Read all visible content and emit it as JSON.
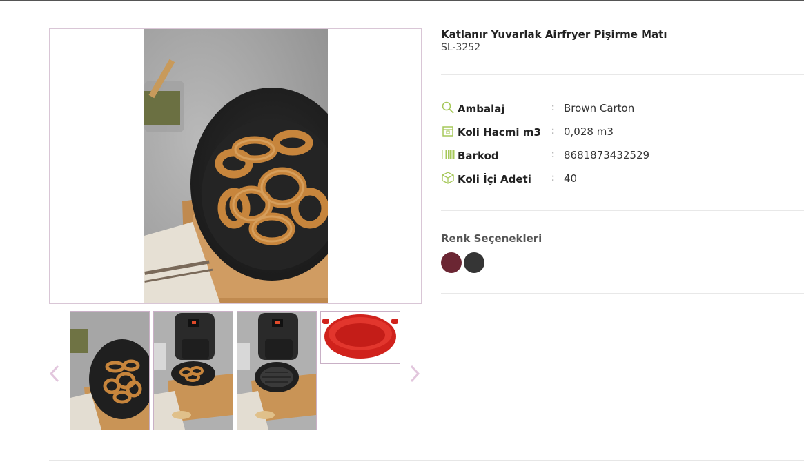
{
  "product": {
    "title": "Katlanır Yuvarlak Airfryer Pişirme Matı",
    "code": "SL-3252"
  },
  "specs": [
    {
      "icon": "magnifier-icon",
      "label": "Ambalaj",
      "value": "Brown Carton"
    },
    {
      "icon": "box-icon",
      "label": "Koli Hacmi m3",
      "value": "0,028 m3"
    },
    {
      "icon": "barcode-icon",
      "label": "Barkod",
      "value": "8681873432529"
    },
    {
      "icon": "package-icon",
      "label": "Koli İçi Adeti",
      "value": "40"
    }
  ],
  "colon": ":",
  "colors": {
    "title": "Renk Seçenekleri",
    "options": [
      {
        "name": "bordo",
        "hex": "#6b2633"
      },
      {
        "name": "siyah",
        "hex": "#353535"
      }
    ]
  },
  "thumbnails": [
    {
      "name": "thumb-onion-rings"
    },
    {
      "name": "thumb-airfryer-rings"
    },
    {
      "name": "thumb-airfryer-empty"
    },
    {
      "name": "thumb-red-mat"
    }
  ],
  "accent": "#a6c85a"
}
